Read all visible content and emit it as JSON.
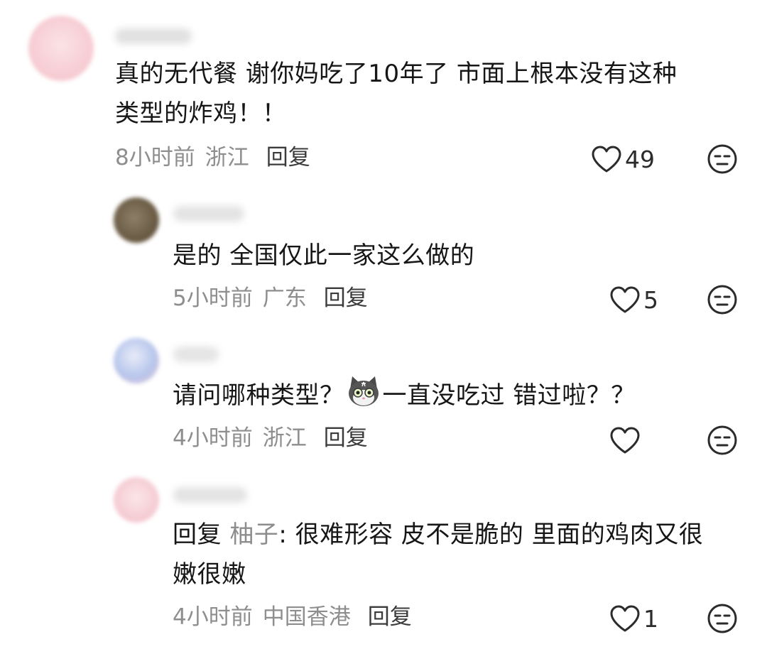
{
  "comments": [
    {
      "text_line1": "真的无代餐 谢你妈吃了10年了 市面上根本没有这种",
      "text_line2": "类型的炸鸡！！",
      "time": "8小时前",
      "location": "浙江",
      "reply_label": "回复",
      "likes": "49"
    },
    {
      "text_line1": "是的 全国仅此一家这么做的",
      "time": "5小时前",
      "location": "广东",
      "reply_label": "回复",
      "likes": "5"
    },
    {
      "text_before_emoji": "请问哪种类型？",
      "emoji": "cat-emoji",
      "text_after_emoji": "一直没吃过 错过啦？？",
      "time": "4小时前",
      "location": "浙江",
      "reply_label": "回复",
      "likes": ""
    },
    {
      "reply_prefix": "回复 ",
      "mention": "柚子",
      "text_line1": ": 很难形容 皮不是脆的 里面的鸡肉又很",
      "text_line2": "嫩很嫩",
      "time": "4小时前",
      "location": "中国香港",
      "reply_label": "回复",
      "likes": "1"
    }
  ],
  "icons": {
    "like": "heart-outline-icon",
    "dislike": "neutral-face-icon"
  },
  "colors": {
    "text": "#161616",
    "meta": "#8e8e8e",
    "mention": "#8d8d8d"
  }
}
